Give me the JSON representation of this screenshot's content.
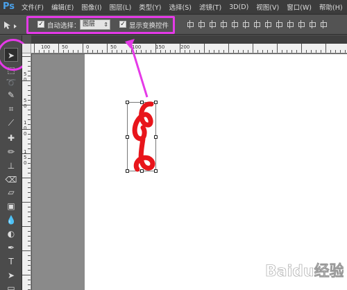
{
  "app": {
    "logo": "Ps",
    "menus": [
      "文件(F)",
      "编辑(E)",
      "图像(I)",
      "图层(L)",
      "类型(Y)",
      "选择(S)",
      "滤镜(T)",
      "3D(D)",
      "视图(V)",
      "窗口(W)",
      "帮助(H)"
    ]
  },
  "options": {
    "auto_select_label": "自动选择：",
    "auto_select_checked": true,
    "auto_select_value": "图层",
    "show_transform_label": "显示变换控件",
    "show_transform_checked": true
  },
  "rulers": {
    "top_ticks": [
      "100",
      "50",
      "0",
      "50",
      "100",
      "150",
      "200"
    ],
    "left_ticks": [
      "5",
      "0",
      "5",
      "0",
      "1",
      "0",
      "0",
      "1",
      "5",
      "0"
    ]
  },
  "colors": {
    "highlight": "#e53ae8",
    "glyph": "#e8151b"
  },
  "watermark": "Baidu经验"
}
